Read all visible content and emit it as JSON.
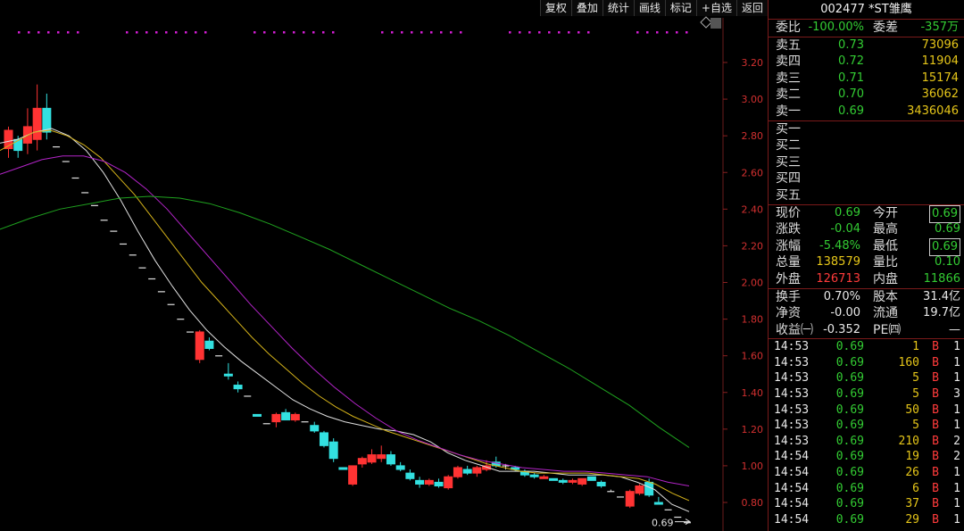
{
  "toolbar": [
    "复权",
    "叠加",
    "统计",
    "画线",
    "标记",
    "+自选",
    "返回"
  ],
  "chart_data": {
    "type": "candlestick",
    "y_ticks": [
      "3.20",
      "3.00",
      "2.80",
      "2.60",
      "2.40",
      "2.20",
      "2.00",
      "1.80",
      "1.60",
      "1.40",
      "1.20",
      "1.00",
      "0.80"
    ],
    "ylim": [
      0.69,
      3.4
    ],
    "last_price_label": "0.69",
    "candles": [
      {
        "o": 2.73,
        "h": 2.85,
        "l": 2.68,
        "c": 2.83
      },
      {
        "o": 2.78,
        "h": 2.8,
        "l": 2.68,
        "c": 2.72
      },
      {
        "o": 2.76,
        "h": 2.95,
        "l": 2.7,
        "c": 2.85
      },
      {
        "o": 2.78,
        "h": 3.08,
        "l": 2.72,
        "c": 2.95
      },
      {
        "o": 2.95,
        "h": 3.03,
        "l": 2.78,
        "c": 2.82
      },
      {
        "o": 2.74,
        "h": 2.74,
        "l": 2.74,
        "c": 2.74
      },
      {
        "o": 2.66,
        "h": 2.66,
        "l": 2.66,
        "c": 2.66
      },
      {
        "o": 2.57,
        "h": 2.57,
        "l": 2.57,
        "c": 2.57
      },
      {
        "o": 2.49,
        "h": 2.49,
        "l": 2.49,
        "c": 2.49
      },
      {
        "o": 2.42,
        "h": 2.42,
        "l": 2.42,
        "c": 2.42
      },
      {
        "o": 2.34,
        "h": 2.34,
        "l": 2.34,
        "c": 2.34
      },
      {
        "o": 2.28,
        "h": 2.28,
        "l": 2.28,
        "c": 2.28
      },
      {
        "o": 2.21,
        "h": 2.21,
        "l": 2.21,
        "c": 2.21
      },
      {
        "o": 2.15,
        "h": 2.15,
        "l": 2.15,
        "c": 2.15
      },
      {
        "o": 2.08,
        "h": 2.08,
        "l": 2.08,
        "c": 2.08
      },
      {
        "o": 2.02,
        "h": 2.02,
        "l": 2.02,
        "c": 2.02
      },
      {
        "o": 1.95,
        "h": 1.95,
        "l": 1.95,
        "c": 1.95
      },
      {
        "o": 1.88,
        "h": 1.88,
        "l": 1.88,
        "c": 1.88
      },
      {
        "o": 1.8,
        "h": 1.8,
        "l": 1.8,
        "c": 1.8
      },
      {
        "o": 1.73,
        "h": 1.73,
        "l": 1.73,
        "c": 1.73
      },
      {
        "o": 1.58,
        "h": 1.74,
        "l": 1.56,
        "c": 1.73
      },
      {
        "o": 1.68,
        "h": 1.7,
        "l": 1.63,
        "c": 1.64
      },
      {
        "o": 1.6,
        "h": 1.6,
        "l": 1.6,
        "c": 1.6
      },
      {
        "o": 1.5,
        "h": 1.56,
        "l": 1.47,
        "c": 1.49
      },
      {
        "o": 1.44,
        "h": 1.46,
        "l": 1.4,
        "c": 1.42
      },
      {
        "o": 1.38,
        "h": 1.38,
        "l": 1.38,
        "c": 1.38
      },
      {
        "o": 1.28,
        "h": 1.28,
        "l": 1.27,
        "c": 1.27
      },
      {
        "o": 1.23,
        "h": 1.23,
        "l": 1.23,
        "c": 1.23
      },
      {
        "o": 1.24,
        "h": 1.29,
        "l": 1.21,
        "c": 1.28
      },
      {
        "o": 1.29,
        "h": 1.31,
        "l": 1.25,
        "c": 1.25
      },
      {
        "o": 1.25,
        "h": 1.29,
        "l": 1.24,
        "c": 1.28
      },
      {
        "o": 1.24,
        "h": 1.24,
        "l": 1.24,
        "c": 1.24
      },
      {
        "o": 1.22,
        "h": 1.24,
        "l": 1.18,
        "c": 1.19
      },
      {
        "o": 1.18,
        "h": 1.19,
        "l": 1.1,
        "c": 1.11
      },
      {
        "o": 1.13,
        "h": 1.15,
        "l": 1.02,
        "c": 1.04
      },
      {
        "o": 0.99,
        "h": 0.99,
        "l": 0.98,
        "c": 0.98
      },
      {
        "o": 0.9,
        "h": 1.0,
        "l": 0.89,
        "c": 1.0
      },
      {
        "o": 1.01,
        "h": 1.05,
        "l": 0.99,
        "c": 1.04
      },
      {
        "o": 1.02,
        "h": 1.09,
        "l": 1.01,
        "c": 1.06
      },
      {
        "o": 1.04,
        "h": 1.11,
        "l": 1.02,
        "c": 1.06
      },
      {
        "o": 1.06,
        "h": 1.08,
        "l": 1.0,
        "c": 1.01
      },
      {
        "o": 1.0,
        "h": 1.02,
        "l": 0.97,
        "c": 0.98
      },
      {
        "o": 0.96,
        "h": 0.98,
        "l": 0.92,
        "c": 0.93
      },
      {
        "o": 0.92,
        "h": 0.94,
        "l": 0.88,
        "c": 0.9
      },
      {
        "o": 0.9,
        "h": 0.93,
        "l": 0.89,
        "c": 0.92
      },
      {
        "o": 0.91,
        "h": 0.93,
        "l": 0.88,
        "c": 0.89
      },
      {
        "o": 0.88,
        "h": 0.95,
        "l": 0.87,
        "c": 0.94
      },
      {
        "o": 0.94,
        "h": 1.0,
        "l": 0.93,
        "c": 0.99
      },
      {
        "o": 0.98,
        "h": 1.0,
        "l": 0.95,
        "c": 0.96
      },
      {
        "o": 0.96,
        "h": 1.0,
        "l": 0.94,
        "c": 0.99
      },
      {
        "o": 0.98,
        "h": 1.03,
        "l": 0.97,
        "c": 1.0
      },
      {
        "o": 1.02,
        "h": 1.05,
        "l": 0.99,
        "c": 1.0
      },
      {
        "o": 1.0,
        "h": 1.01,
        "l": 0.98,
        "c": 1.0
      },
      {
        "o": 0.99,
        "h": 1.0,
        "l": 0.97,
        "c": 0.98
      },
      {
        "o": 0.97,
        "h": 0.98,
        "l": 0.94,
        "c": 0.95
      },
      {
        "o": 0.95,
        "h": 0.96,
        "l": 0.93,
        "c": 0.94
      },
      {
        "o": 0.93,
        "h": 0.95,
        "l": 0.93,
        "c": 0.94
      },
      {
        "o": 0.93,
        "h": 0.93,
        "l": 0.92,
        "c": 0.92
      },
      {
        "o": 0.92,
        "h": 0.93,
        "l": 0.9,
        "c": 0.91
      },
      {
        "o": 0.91,
        "h": 0.93,
        "l": 0.9,
        "c": 0.92
      },
      {
        "o": 0.9,
        "h": 0.93,
        "l": 0.89,
        "c": 0.93
      },
      {
        "o": 0.94,
        "h": 0.94,
        "l": 0.92,
        "c": 0.92
      },
      {
        "o": 0.91,
        "h": 0.92,
        "l": 0.88,
        "c": 0.89
      },
      {
        "o": 0.86,
        "h": 0.87,
        "l": 0.86,
        "c": 0.86
      },
      {
        "o": 0.83,
        "h": 0.83,
        "l": 0.83,
        "c": 0.83
      },
      {
        "o": 0.78,
        "h": 0.87,
        "l": 0.77,
        "c": 0.86
      },
      {
        "o": 0.85,
        "h": 0.9,
        "l": 0.84,
        "c": 0.89
      },
      {
        "o": 0.91,
        "h": 0.93,
        "l": 0.83,
        "c": 0.84
      },
      {
        "o": 0.8,
        "h": 0.83,
        "l": 0.79,
        "c": 0.79
      },
      {
        "o": 0.76,
        "h": 0.76,
        "l": 0.76,
        "c": 0.76
      },
      {
        "o": 0.72,
        "h": 0.72,
        "l": 0.72,
        "c": 0.72
      },
      {
        "o": 0.69,
        "h": 0.69,
        "l": 0.69,
        "c": 0.69
      }
    ],
    "ma_lines": [
      {
        "color": "#e0e0e0",
        "values": [
          2.76,
          2.78,
          2.82,
          2.84,
          2.8,
          2.72,
          2.6,
          2.45,
          2.28,
          2.12,
          1.98,
          1.85,
          1.74,
          1.65,
          1.57,
          1.5,
          1.43,
          1.36,
          1.31,
          1.27,
          1.24,
          1.22,
          1.2,
          1.19,
          1.17,
          1.13,
          1.07,
          1.03,
          1.0,
          0.97,
          0.97,
          0.97,
          0.96,
          0.95,
          0.95,
          0.95,
          0.94,
          0.91,
          0.87,
          0.79,
          0.75
        ]
      },
      {
        "color": "#d4b21a",
        "values": [
          2.72,
          2.77,
          2.82,
          2.83,
          2.8,
          2.75,
          2.68,
          2.58,
          2.48,
          2.36,
          2.24,
          2.12,
          2.0,
          1.9,
          1.8,
          1.7,
          1.61,
          1.53,
          1.45,
          1.38,
          1.32,
          1.27,
          1.23,
          1.19,
          1.16,
          1.13,
          1.1,
          1.07,
          1.04,
          1.01,
          0.99,
          0.97,
          0.96,
          0.96,
          0.96,
          0.96,
          0.95,
          0.94,
          0.93,
          0.9,
          0.85,
          0.81
        ]
      },
      {
        "color": "#b324c8",
        "values": [
          2.59,
          2.63,
          2.67,
          2.69,
          2.69,
          2.66,
          2.6,
          2.51,
          2.4,
          2.27,
          2.14,
          2.01,
          1.88,
          1.76,
          1.64,
          1.53,
          1.43,
          1.34,
          1.26,
          1.19,
          1.14,
          1.1,
          1.06,
          1.03,
          1.01,
          0.99,
          0.98,
          0.97,
          0.97,
          0.96,
          0.95,
          0.94,
          0.91,
          0.89
        ]
      },
      {
        "color": "#1fa21f",
        "values": [
          2.29,
          2.35,
          2.4,
          2.43,
          2.46,
          2.47,
          2.46,
          2.43,
          2.38,
          2.32,
          2.25,
          2.18,
          2.1,
          2.02,
          1.94,
          1.86,
          1.79,
          1.71,
          1.62,
          1.53,
          1.43,
          1.33,
          1.21,
          1.1
        ]
      }
    ]
  },
  "panel": {
    "title": "002477 *ST雏鹰",
    "weibi": {
      "label1": "委比",
      "v1": "-100.00%",
      "label2": "委差",
      "v2": "-357万"
    },
    "asks": [
      {
        "label": "卖五",
        "price": "0.73",
        "vol": "73096"
      },
      {
        "label": "卖四",
        "price": "0.72",
        "vol": "11904"
      },
      {
        "label": "卖三",
        "price": "0.71",
        "vol": "15174"
      },
      {
        "label": "卖二",
        "price": "0.70",
        "vol": "36062"
      },
      {
        "label": "卖一",
        "price": "0.69",
        "vol": "3436046"
      }
    ],
    "bids": [
      {
        "label": "买一"
      },
      {
        "label": "买二"
      },
      {
        "label": "买三"
      },
      {
        "label": "买四"
      },
      {
        "label": "买五"
      }
    ],
    "quote": [
      {
        "l1": "现价",
        "v1": "0.69",
        "l2": "今开",
        "v2": "0.69"
      },
      {
        "l1": "涨跌",
        "v1": "-0.04",
        "l2": "最高",
        "v2": "0.69"
      },
      {
        "l1": "涨幅",
        "v1": "-5.48%",
        "l2": "最低",
        "v2": "0.69"
      },
      {
        "l1": "总量",
        "v1": "138579",
        "l2": "量比",
        "v2": "0.10"
      },
      {
        "l1": "外盘",
        "v1": "126713",
        "l2": "内盘",
        "v2": "11866"
      }
    ],
    "info": [
      {
        "l1": "换手",
        "v1": "0.70%",
        "l2": "股本",
        "v2": "31.4亿"
      },
      {
        "l1": "净资",
        "v1": "-0.00",
        "l2": "流通",
        "v2": "19.7亿"
      },
      {
        "l1": "收益㈠",
        "v1": "-0.352",
        "l2": "PE㈣",
        "v2": "—"
      }
    ],
    "ticks": [
      {
        "t": "14:53",
        "p": "0.69",
        "v": "1",
        "s": "B",
        "n": "1"
      },
      {
        "t": "14:53",
        "p": "0.69",
        "v": "160",
        "s": "B",
        "n": "1"
      },
      {
        "t": "14:53",
        "p": "0.69",
        "v": "5",
        "s": "B",
        "n": "1"
      },
      {
        "t": "14:53",
        "p": "0.69",
        "v": "5",
        "s": "B",
        "n": "3"
      },
      {
        "t": "14:53",
        "p": "0.69",
        "v": "50",
        "s": "B",
        "n": "1"
      },
      {
        "t": "14:53",
        "p": "0.69",
        "v": "5",
        "s": "B",
        "n": "1"
      },
      {
        "t": "14:53",
        "p": "0.69",
        "v": "210",
        "s": "B",
        "n": "2"
      },
      {
        "t": "14:54",
        "p": "0.69",
        "v": "19",
        "s": "B",
        "n": "2"
      },
      {
        "t": "14:54",
        "p": "0.69",
        "v": "26",
        "s": "B",
        "n": "1"
      },
      {
        "t": "14:54",
        "p": "0.69",
        "v": "6",
        "s": "B",
        "n": "1"
      },
      {
        "t": "14:54",
        "p": "0.69",
        "v": "37",
        "s": "B",
        "n": "1"
      },
      {
        "t": "14:54",
        "p": "0.69",
        "v": "29",
        "s": "B",
        "n": "1"
      }
    ]
  }
}
